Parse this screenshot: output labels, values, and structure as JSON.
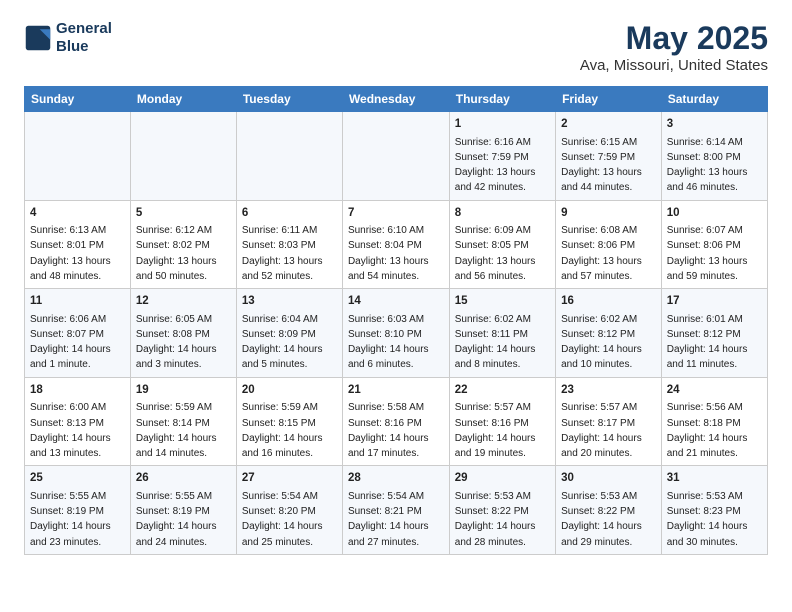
{
  "logo": {
    "line1": "General",
    "line2": "Blue"
  },
  "title": "May 2025",
  "subtitle": "Ava, Missouri, United States",
  "days_of_week": [
    "Sunday",
    "Monday",
    "Tuesday",
    "Wednesday",
    "Thursday",
    "Friday",
    "Saturday"
  ],
  "weeks": [
    [
      {
        "day": "",
        "content": ""
      },
      {
        "day": "",
        "content": ""
      },
      {
        "day": "",
        "content": ""
      },
      {
        "day": "",
        "content": ""
      },
      {
        "day": "1",
        "content": "Sunrise: 6:16 AM\nSunset: 7:59 PM\nDaylight: 13 hours\nand 42 minutes."
      },
      {
        "day": "2",
        "content": "Sunrise: 6:15 AM\nSunset: 7:59 PM\nDaylight: 13 hours\nand 44 minutes."
      },
      {
        "day": "3",
        "content": "Sunrise: 6:14 AM\nSunset: 8:00 PM\nDaylight: 13 hours\nand 46 minutes."
      }
    ],
    [
      {
        "day": "4",
        "content": "Sunrise: 6:13 AM\nSunset: 8:01 PM\nDaylight: 13 hours\nand 48 minutes."
      },
      {
        "day": "5",
        "content": "Sunrise: 6:12 AM\nSunset: 8:02 PM\nDaylight: 13 hours\nand 50 minutes."
      },
      {
        "day": "6",
        "content": "Sunrise: 6:11 AM\nSunset: 8:03 PM\nDaylight: 13 hours\nand 52 minutes."
      },
      {
        "day": "7",
        "content": "Sunrise: 6:10 AM\nSunset: 8:04 PM\nDaylight: 13 hours\nand 54 minutes."
      },
      {
        "day": "8",
        "content": "Sunrise: 6:09 AM\nSunset: 8:05 PM\nDaylight: 13 hours\nand 56 minutes."
      },
      {
        "day": "9",
        "content": "Sunrise: 6:08 AM\nSunset: 8:06 PM\nDaylight: 13 hours\nand 57 minutes."
      },
      {
        "day": "10",
        "content": "Sunrise: 6:07 AM\nSunset: 8:06 PM\nDaylight: 13 hours\nand 59 minutes."
      }
    ],
    [
      {
        "day": "11",
        "content": "Sunrise: 6:06 AM\nSunset: 8:07 PM\nDaylight: 14 hours\nand 1 minute."
      },
      {
        "day": "12",
        "content": "Sunrise: 6:05 AM\nSunset: 8:08 PM\nDaylight: 14 hours\nand 3 minutes."
      },
      {
        "day": "13",
        "content": "Sunrise: 6:04 AM\nSunset: 8:09 PM\nDaylight: 14 hours\nand 5 minutes."
      },
      {
        "day": "14",
        "content": "Sunrise: 6:03 AM\nSunset: 8:10 PM\nDaylight: 14 hours\nand 6 minutes."
      },
      {
        "day": "15",
        "content": "Sunrise: 6:02 AM\nSunset: 8:11 PM\nDaylight: 14 hours\nand 8 minutes."
      },
      {
        "day": "16",
        "content": "Sunrise: 6:02 AM\nSunset: 8:12 PM\nDaylight: 14 hours\nand 10 minutes."
      },
      {
        "day": "17",
        "content": "Sunrise: 6:01 AM\nSunset: 8:12 PM\nDaylight: 14 hours\nand 11 minutes."
      }
    ],
    [
      {
        "day": "18",
        "content": "Sunrise: 6:00 AM\nSunset: 8:13 PM\nDaylight: 14 hours\nand 13 minutes."
      },
      {
        "day": "19",
        "content": "Sunrise: 5:59 AM\nSunset: 8:14 PM\nDaylight: 14 hours\nand 14 minutes."
      },
      {
        "day": "20",
        "content": "Sunrise: 5:59 AM\nSunset: 8:15 PM\nDaylight: 14 hours\nand 16 minutes."
      },
      {
        "day": "21",
        "content": "Sunrise: 5:58 AM\nSunset: 8:16 PM\nDaylight: 14 hours\nand 17 minutes."
      },
      {
        "day": "22",
        "content": "Sunrise: 5:57 AM\nSunset: 8:16 PM\nDaylight: 14 hours\nand 19 minutes."
      },
      {
        "day": "23",
        "content": "Sunrise: 5:57 AM\nSunset: 8:17 PM\nDaylight: 14 hours\nand 20 minutes."
      },
      {
        "day": "24",
        "content": "Sunrise: 5:56 AM\nSunset: 8:18 PM\nDaylight: 14 hours\nand 21 minutes."
      }
    ],
    [
      {
        "day": "25",
        "content": "Sunrise: 5:55 AM\nSunset: 8:19 PM\nDaylight: 14 hours\nand 23 minutes."
      },
      {
        "day": "26",
        "content": "Sunrise: 5:55 AM\nSunset: 8:19 PM\nDaylight: 14 hours\nand 24 minutes."
      },
      {
        "day": "27",
        "content": "Sunrise: 5:54 AM\nSunset: 8:20 PM\nDaylight: 14 hours\nand 25 minutes."
      },
      {
        "day": "28",
        "content": "Sunrise: 5:54 AM\nSunset: 8:21 PM\nDaylight: 14 hours\nand 27 minutes."
      },
      {
        "day": "29",
        "content": "Sunrise: 5:53 AM\nSunset: 8:22 PM\nDaylight: 14 hours\nand 28 minutes."
      },
      {
        "day": "30",
        "content": "Sunrise: 5:53 AM\nSunset: 8:22 PM\nDaylight: 14 hours\nand 29 minutes."
      },
      {
        "day": "31",
        "content": "Sunrise: 5:53 AM\nSunset: 8:23 PM\nDaylight: 14 hours\nand 30 minutes."
      }
    ]
  ]
}
